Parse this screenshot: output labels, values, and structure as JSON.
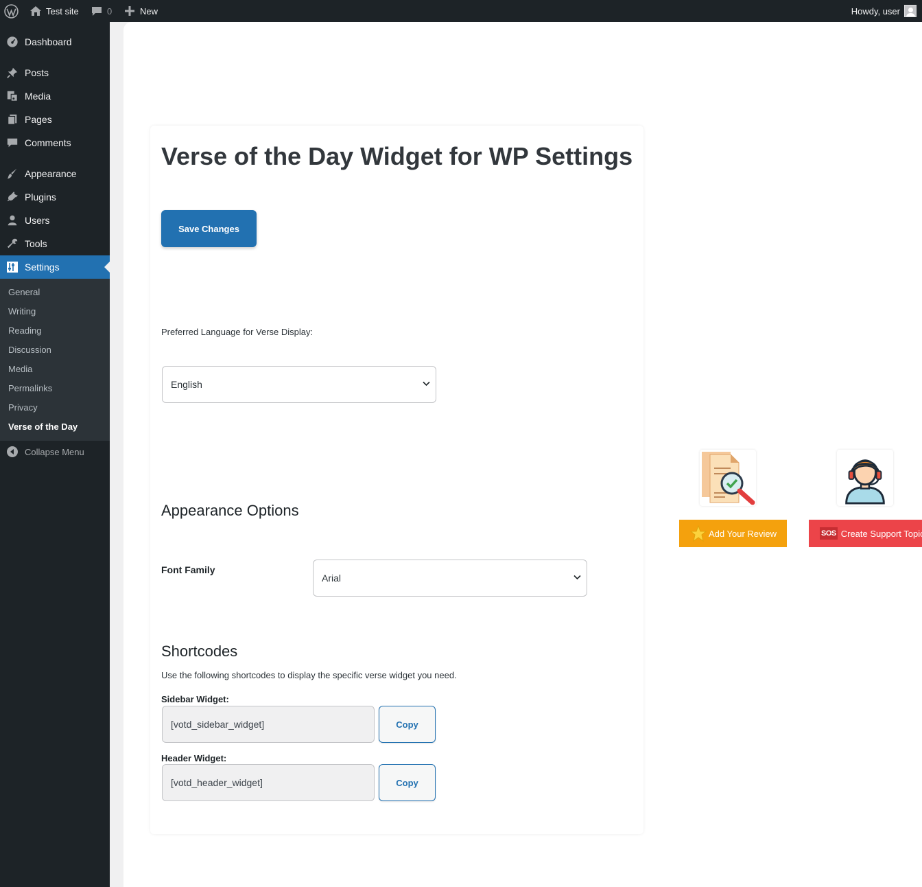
{
  "adminbar": {
    "site_name": "Test site",
    "comments_count": "0",
    "new_label": "New",
    "howdy": "Howdy, user"
  },
  "sidebar": {
    "items": [
      {
        "label": "Dashboard",
        "icon": "dashboard-icon"
      },
      {
        "label": "Posts",
        "icon": "pin-icon"
      },
      {
        "label": "Media",
        "icon": "media-icon"
      },
      {
        "label": "Pages",
        "icon": "pages-icon"
      },
      {
        "label": "Comments",
        "icon": "comment-icon"
      },
      {
        "label": "Appearance",
        "icon": "brush-icon"
      },
      {
        "label": "Plugins",
        "icon": "plug-icon"
      },
      {
        "label": "Users",
        "icon": "user-icon"
      },
      {
        "label": "Tools",
        "icon": "wrench-icon"
      },
      {
        "label": "Settings",
        "icon": "sliders-icon"
      }
    ],
    "submenu": [
      "General",
      "Writing",
      "Reading",
      "Discussion",
      "Media",
      "Permalinks",
      "Privacy",
      "Verse of the Day"
    ],
    "collapse_label": "Collapse Menu"
  },
  "main": {
    "title": "Verse of the Day Widget for WP Settings",
    "save_label": "Save Changes",
    "language_label": "Preferred Language for Verse Display:",
    "language_value": "English",
    "appearance_heading": "Appearance Options",
    "font_family_label": "Font Family",
    "font_family_value": "Arial",
    "shortcodes_heading": "Shortcodes",
    "shortcodes_desc": "Use the following shortcodes to display the specific verse widget you need.",
    "sidebar_widget_label": "Sidebar Widget:",
    "sidebar_widget_code": "[votd_sidebar_widget]",
    "header_widget_label": "Header Widget:",
    "header_widget_code": "[votd_header_widget]",
    "copy_label": "Copy"
  },
  "promo": {
    "review_label": "Add Your Review",
    "support_label": "Create Support Topic",
    "sos_text": "SOS"
  },
  "colors": {
    "adminbar_bg": "#1d2327",
    "accent": "#2271b1",
    "review": "#f4a10d",
    "support": "#ec4449"
  }
}
